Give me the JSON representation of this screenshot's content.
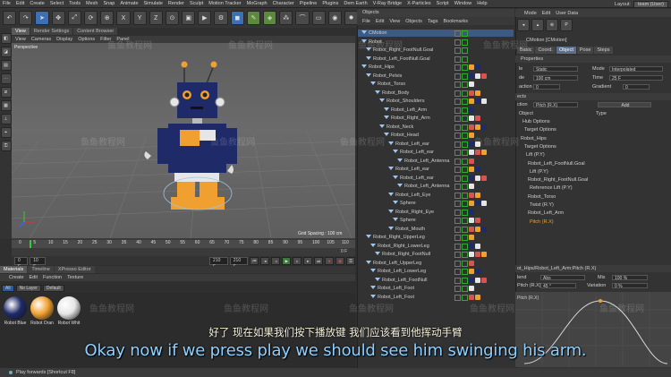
{
  "menubar": {
    "items": [
      "File",
      "Edit",
      "Create",
      "Select",
      "Tools",
      "Mesh",
      "Snap",
      "Animate",
      "Simulate",
      "Render",
      "Sculpt",
      "Motion Tracker",
      "MoGraph",
      "Character",
      "Pipeline",
      "Plugins",
      "Dem Earth",
      "V-Ray Bridge",
      "X-Particles",
      "Script",
      "Window",
      "Help"
    ],
    "layout_label": "Layout:",
    "layout_value": "team (User)"
  },
  "viewport": {
    "tabs": [
      "View",
      "Render Settings",
      "Content Browser"
    ],
    "menu": [
      "View",
      "Cameras",
      "Display",
      "Options",
      "Filter",
      "Panel"
    ],
    "label": "Perspective",
    "grid_spacing": "Grid Spacing : 100 cm"
  },
  "timeline": {
    "ticks": [
      "0",
      "5",
      "10",
      "15",
      "20",
      "25",
      "30",
      "35",
      "40",
      "45",
      "50",
      "55",
      "60",
      "65",
      "70",
      "75",
      "80",
      "85",
      "90",
      "95",
      "100",
      "105",
      "110"
    ],
    "frame_end": "210 F",
    "current_frame": "0 F",
    "field_10": "10 F",
    "field_0": "0 F",
    "field_210": "210 F"
  },
  "materials": {
    "tabs": [
      "Materials",
      "Timeline",
      "XPresso Editor"
    ],
    "menu": [
      "Create",
      "Edit",
      "Function",
      "Texture"
    ],
    "filters": [
      "All",
      "No Layer",
      "Default"
    ],
    "items": [
      {
        "label": "Robot Blue",
        "color": "#1f2a68"
      },
      {
        "label": "Robot Oran",
        "color": "#f0a030"
      },
      {
        "label": "Robot Whit",
        "color": "#e6e6e6"
      }
    ]
  },
  "objects": {
    "title": "Objects",
    "menu": [
      "File",
      "Edit",
      "View",
      "Objects",
      "Tags",
      "Bookmarks"
    ],
    "rows": [
      {
        "name": "CMotion",
        "indent": 0,
        "sel": true
      },
      {
        "name": "Robot",
        "indent": 0
      },
      {
        "name": "Robot_Right_FootNull.Goal",
        "indent": 1
      },
      {
        "name": "Robot_Left_FootNull.Goal",
        "indent": 1
      },
      {
        "name": "Robot_Hips",
        "indent": 0
      },
      {
        "name": "Robot_Pelvis",
        "indent": 1
      },
      {
        "name": "Robot_Torso",
        "indent": 2
      },
      {
        "name": "Robot_Body",
        "indent": 3
      },
      {
        "name": "Robot_Shoulders",
        "indent": 4
      },
      {
        "name": "Robot_Left_Arm",
        "indent": 5
      },
      {
        "name": "Robot_Right_Arm",
        "indent": 5
      },
      {
        "name": "Robot_Neck",
        "indent": 4
      },
      {
        "name": "Robot_Head",
        "indent": 5
      },
      {
        "name": "Robot_Left_ear",
        "indent": 6
      },
      {
        "name": "Robot_Left_ear",
        "indent": 7
      },
      {
        "name": "Robot_Left_Antenna",
        "indent": 8
      },
      {
        "name": "Robot_Left_ear",
        "indent": 6
      },
      {
        "name": "Robot_Left_ear",
        "indent": 7
      },
      {
        "name": "Robot_Left_Antenna",
        "indent": 8
      },
      {
        "name": "Robot_Left_Eye",
        "indent": 6
      },
      {
        "name": "Sphere",
        "indent": 7
      },
      {
        "name": "Robot_Right_Eye",
        "indent": 6
      },
      {
        "name": "Sphere",
        "indent": 7
      },
      {
        "name": "Robot_Mouth",
        "indent": 6
      },
      {
        "name": "Robot_Right_UpperLeg",
        "indent": 1
      },
      {
        "name": "Robot_Right_LowerLeg",
        "indent": 2
      },
      {
        "name": "Robot_Right_FootNull",
        "indent": 3
      },
      {
        "name": "Robot_Left_UpperLeg",
        "indent": 1
      },
      {
        "name": "Robot_Left_LowerLeg",
        "indent": 2
      },
      {
        "name": "Robot_Left_FootNull",
        "indent": 3
      },
      {
        "name": "Robot_Left_Foot",
        "indent": 2
      },
      {
        "name": "Robot_Left_Foot",
        "indent": 2
      }
    ]
  },
  "attributes": {
    "menu": [
      "Mode",
      "Edit",
      "User Data"
    ],
    "object_label": "CMotion [CMotion]",
    "tabs": [
      "Basic",
      "Coord.",
      "Object",
      "Pose",
      "Steps"
    ],
    "properties": "Properties",
    "rows": {
      "type_label": "le",
      "type_val": "Static",
      "mode_label": "Mode",
      "mode_val": "Interpolated",
      "dist_label": "de",
      "dist_val": "100 cm",
      "time_label": "Time",
      "time_val": "25 F",
      "action_label": "action",
      "action_val": "0",
      "gradient_label": "Gradient",
      "gradient_val": "0",
      "objects_label": "ects",
      "target_label": "ction",
      "target_val": "Pitch (R.X)",
      "add_label": "Add",
      "object_head": "Object",
      "type_head": "Type",
      "tree": [
        "Hub Options",
        "Target Options",
        "Robot_Hips",
        "Target Options",
        "Lift (P.Y)",
        "Robot_Left_FootNull.Goal",
        "Lift (P.Y)",
        "Robot_Right_FootNull.Goal",
        "Reference Lift (P.Y)",
        "Robot_Torso",
        "Twist (R.Y)",
        "Robot_Left_Arm",
        "Pitch (R.X)"
      ]
    },
    "curve_title": "ot_Hips/Robot_Left_Arm:Pitch (R.X)",
    "bend_label": "lend",
    "bend_val": "Abs",
    "mix_label": "Mix",
    "mix_val": "100 %",
    "pitch_label": "Pitch (R.X)",
    "pitch_val": "45 °",
    "variation_label": "Variation",
    "variation_val": "0 %",
    "pitch2_label": "Pitch (R.X)"
  },
  "subtitles": {
    "cn": "好了  现在如果我们按下播放键  我们应该看到他挥动手臂",
    "en": "Okay now if we press play we should see him swinging his arm."
  },
  "status": {
    "text": "Play forwards [Shortcut F8]"
  },
  "watermark": "鱼鱼教程网"
}
